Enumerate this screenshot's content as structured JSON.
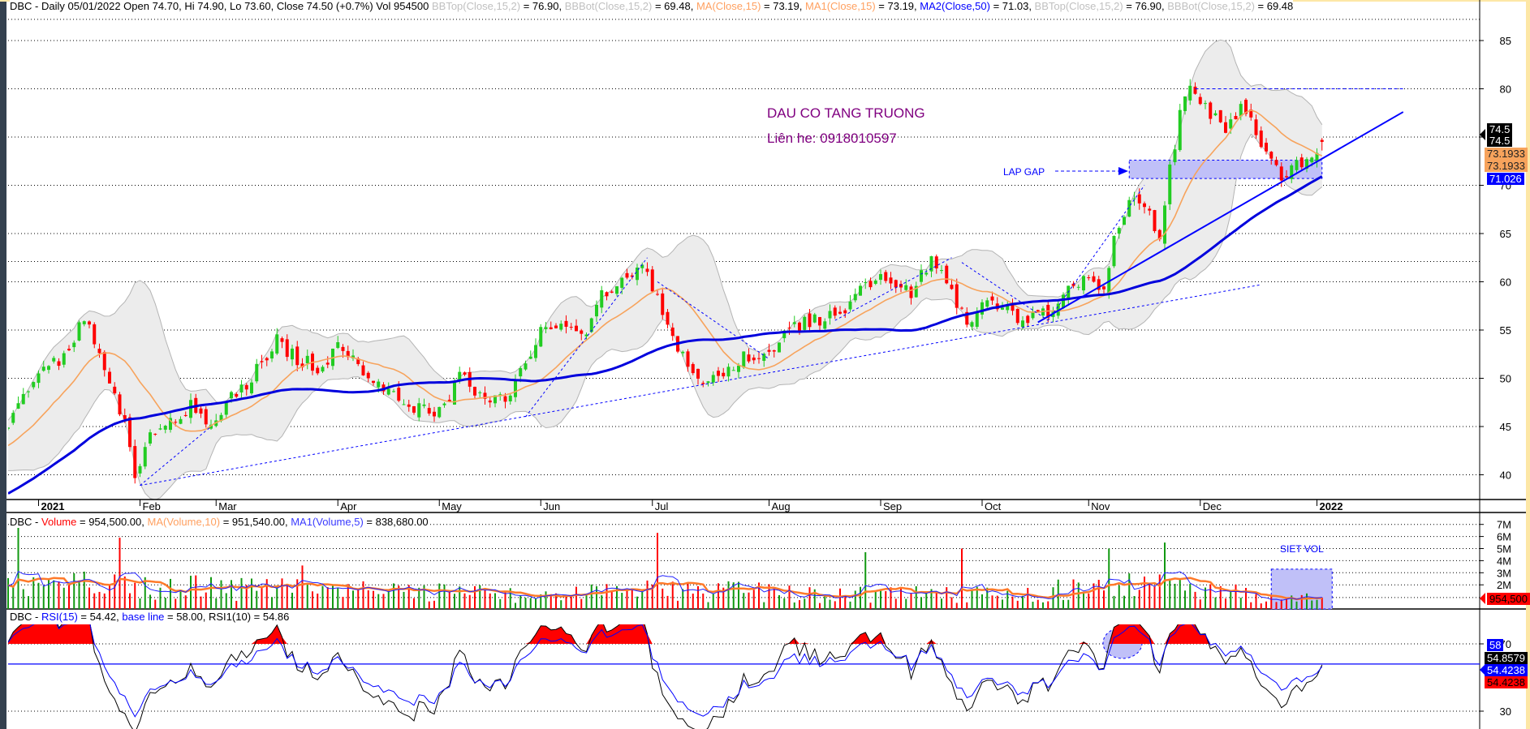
{
  "price_header": {
    "prefix": "DBC - Daily 05/01/2022 Open 74.70, Hi 74.90, Lo 73.60, Close 74.50 (+0.7%) Vol 954500 ",
    "bbtop1_label": "BBTop(Close,15,2)",
    "bbtop1_value": " = 76.90, ",
    "bbbot1_label": "BBBot(Close,15,2)",
    "bbbot1_value": " = 69.48, ",
    "ma_label": "MA(Close,15)",
    "ma_value": " = 73.19, ",
    "ma1_label": "MA1(Close,15)",
    "ma1_value": " = 73.19, ",
    "ma2_label": "MA2(Close,50)",
    "ma2_value": " = 71.03, ",
    "bbtop2_label": "BBTop(Close,15,2)",
    "bbtop2_value": " = 76.90, ",
    "bbbot2_label": "BBBot(Close,15,2)",
    "bbbot2_value": " = 69.48"
  },
  "volume_header": {
    "prefix": "DBC - ",
    "vol_label": "Volume",
    "vol_value": " = 954,500.00, ",
    "ma_label": "MA(Volume,10)",
    "ma_value": " = 951,540.00, ",
    "ma1_label": "MA1(Volume,5)",
    "ma1_value": " = 838,680.00"
  },
  "rsi_header": {
    "prefix": "DBC - ",
    "rsi_label": "RSI(15)",
    "rsi_value": " = 54.42, ",
    "base_label": "base line",
    "base_value": " = 58.00, ",
    "rsi1_label": "RSI1(10)",
    "rsi1_value": " = 54.86"
  },
  "annotations": {
    "title": "DAU CO TANG TRUONG",
    "contact": "Liên he: 0918010597",
    "gap_label": "LAP GAP",
    "vol_label": "SIET VOL"
  },
  "price_tags": {
    "close_a": "74.5",
    "close_b": "74.5",
    "ma_a": "73.1933",
    "ma_b": "73.1933",
    "ma2": "71.026"
  },
  "volume_tag": "954,500",
  "rsi_tags": {
    "base": "58",
    "rsi1": "54.8579",
    "rsi_a": "54.4238",
    "rsi_b": "54.4238"
  },
  "colors": {
    "up": "#22cc22",
    "down": "#ff0000",
    "ma15": "#f7a35c",
    "ma50": "#0000dd",
    "bb_fill": "#ececec",
    "bb_line": "#b4b4b4",
    "vol_ma10": "#ff7a2a",
    "vol_ma5": "#2020ff",
    "annotation": "#800080",
    "drawing": "#0000ff"
  },
  "chart_data": {
    "type": "candlestick",
    "symbol": "DBC",
    "period": "Daily",
    "bars": 260,
    "last_bar": {
      "open": 74.7,
      "high": 74.9,
      "low": 73.6,
      "close": 74.5,
      "volume": 954500
    },
    "close_anchors": [
      [
        -60,
        30
      ],
      [
        -30,
        36
      ],
      [
        -10,
        42
      ],
      [
        0,
        45
      ],
      [
        3,
        48
      ],
      [
        6,
        50
      ],
      [
        10,
        52
      ],
      [
        15,
        56
      ],
      [
        18,
        53
      ],
      [
        21,
        48
      ],
      [
        23,
        46
      ],
      [
        25,
        39
      ],
      [
        28,
        44
      ],
      [
        32,
        46
      ],
      [
        36,
        47
      ],
      [
        40,
        45
      ],
      [
        44,
        48
      ],
      [
        48,
        50
      ],
      [
        53,
        54
      ],
      [
        57,
        52
      ],
      [
        62,
        51
      ],
      [
        65,
        53
      ],
      [
        71,
        50.5
      ],
      [
        80,
        47
      ],
      [
        85,
        46.5
      ],
      [
        89,
        50
      ],
      [
        95,
        48
      ],
      [
        98,
        48
      ],
      [
        103,
        52
      ],
      [
        106,
        56
      ],
      [
        114,
        55
      ],
      [
        117,
        59
      ],
      [
        122,
        60
      ],
      [
        125,
        62.5
      ],
      [
        129,
        57
      ],
      [
        133,
        52
      ],
      [
        137,
        50
      ],
      [
        141,
        50
      ],
      [
        145,
        52
      ],
      [
        150,
        52
      ],
      [
        154,
        55
      ],
      [
        158,
        56
      ],
      [
        163,
        56.5
      ],
      [
        170,
        60
      ],
      [
        173,
        60
      ],
      [
        178,
        59
      ],
      [
        182,
        62
      ],
      [
        186,
        59
      ],
      [
        189,
        56
      ],
      [
        193,
        58
      ],
      [
        197,
        57
      ],
      [
        200,
        56
      ],
      [
        204,
        56.5
      ],
      [
        209,
        59
      ],
      [
        212,
        60
      ],
      [
        216,
        59
      ],
      [
        218,
        65
      ],
      [
        222,
        69
      ],
      [
        225,
        68
      ],
      [
        227,
        64
      ],
      [
        229,
        72
      ],
      [
        231,
        77
      ],
      [
        233,
        80
      ],
      [
        237,
        77
      ],
      [
        240,
        76
      ],
      [
        243,
        78
      ],
      [
        246,
        76
      ],
      [
        249,
        72
      ],
      [
        251,
        71
      ],
      [
        254,
        72
      ],
      [
        259,
        74.5
      ]
    ],
    "volume_anchors_M": [
      [
        0,
        2.3
      ],
      [
        30,
        2.0
      ],
      [
        60,
        1.8
      ],
      [
        100,
        1.4
      ],
      [
        130,
        1.7
      ],
      [
        160,
        1.4
      ],
      [
        200,
        1.3
      ],
      [
        215,
        2.2
      ],
      [
        235,
        2.0
      ],
      [
        245,
        1.3
      ],
      [
        259,
        0.9
      ]
    ],
    "volume_spikes_M": [
      [
        2,
        7.0
      ],
      [
        22,
        5.9
      ],
      [
        58,
        3.6
      ],
      [
        128,
        6.3
      ],
      [
        169,
        4.7
      ],
      [
        188,
        5.0
      ],
      [
        217,
        5.0
      ],
      [
        228,
        5.5
      ]
    ],
    "y_ticks": [
      85,
      80,
      75,
      70,
      65,
      60,
      55,
      50,
      45,
      40
    ],
    "extra_levels": [
      87.2,
      62.1
    ],
    "x_ticks": [
      {
        "bar": 6,
        "label": "2021",
        "bold": true
      },
      {
        "bar": 26,
        "label": "Feb"
      },
      {
        "bar": 41,
        "label": "Mar"
      },
      {
        "bar": 65,
        "label": "Apr"
      },
      {
        "bar": 85,
        "label": "May"
      },
      {
        "bar": 105,
        "label": "Jun"
      },
      {
        "bar": 127,
        "label": "Jul"
      },
      {
        "bar": 150,
        "label": "Aug"
      },
      {
        "bar": 172,
        "label": "Sep"
      },
      {
        "bar": 192,
        "label": "Oct"
      },
      {
        "bar": 213,
        "label": "Nov"
      },
      {
        "bar": 235,
        "label": "Dec"
      },
      {
        "bar": 258,
        "label": "2022",
        "bold": true
      }
    ],
    "volume_ticks": [
      {
        "v": 7,
        "label": "7M"
      },
      {
        "v": 6,
        "label": "6M"
      },
      {
        "v": 5,
        "label": "5M"
      },
      {
        "v": 4,
        "label": "4M"
      },
      {
        "v": 3,
        "label": "3M"
      },
      {
        "v": 2,
        "label": "2M"
      }
    ],
    "rsi_ticks": [
      {
        "v": 70,
        "label": "70"
      },
      {
        "v": 30,
        "label": "30"
      }
    ],
    "rsi_base": 58,
    "indicators": [
      "BB(15,2)",
      "MA(Close,15)",
      "MA2(Close,50)",
      "MA(Volume,10)",
      "MA1(Volume,5)",
      "RSI(15)",
      "RSI1(10)"
    ],
    "trendlines": {
      "support_dotted": [
        [
          26,
          38.9
        ],
        [
          247,
          59.7
        ]
      ],
      "support_solid": [
        [
          203,
          55.8
        ],
        [
          275,
          77.6
        ]
      ],
      "resistance_dashed": [
        [
          234,
          80
        ],
        [
          275,
          80
        ]
      ],
      "zigzag_dashed": [
        [
          [
            26,
            38.9
          ],
          [
            40,
            45
          ]
        ],
        [
          [
            102,
            46
          ],
          [
            126,
            62.5
          ]
        ],
        [
          [
            128,
            60
          ],
          [
            150,
            52
          ]
        ],
        [
          [
            163,
            56
          ],
          [
            186,
            62.5
          ]
        ],
        [
          [
            188,
            62
          ],
          [
            205,
            56
          ]
        ],
        [
          [
            205,
            56
          ],
          [
            224,
            70
          ]
        ]
      ]
    },
    "gap_zone": {
      "from_bar": 221,
      "to_bar": 259,
      "low": 70.7,
      "high": 72.6
    },
    "vol_zone": {
      "from_bar": 249,
      "to_bar": 261,
      "low": 0,
      "high": 3.3
    }
  }
}
